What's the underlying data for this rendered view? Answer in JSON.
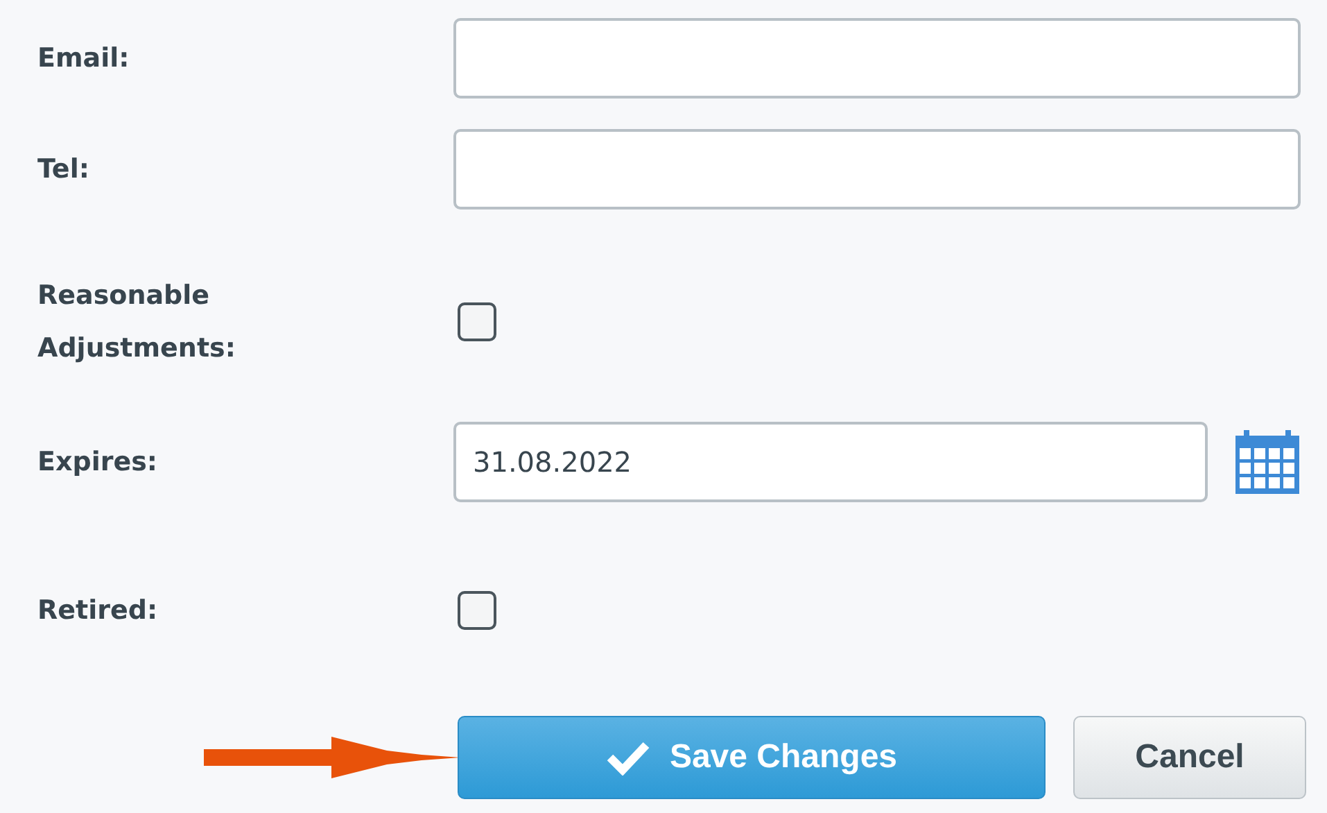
{
  "fields": [
    {
      "kind": "text",
      "label": "Email:"
    },
    {
      "kind": "text",
      "label": "Tel:"
    },
    {
      "kind": "checkbox",
      "label": "Reasonable Adjustments:",
      "checked": false
    },
    {
      "kind": "date",
      "label": "Expires:",
      "value": "31.08.2022"
    },
    {
      "kind": "checkbox",
      "label": "Retired:",
      "checked": false
    }
  ],
  "buttons": [
    {
      "kind": "primary",
      "label": "Save Changes"
    },
    {
      "kind": "secondary",
      "label": "Cancel"
    }
  ]
}
